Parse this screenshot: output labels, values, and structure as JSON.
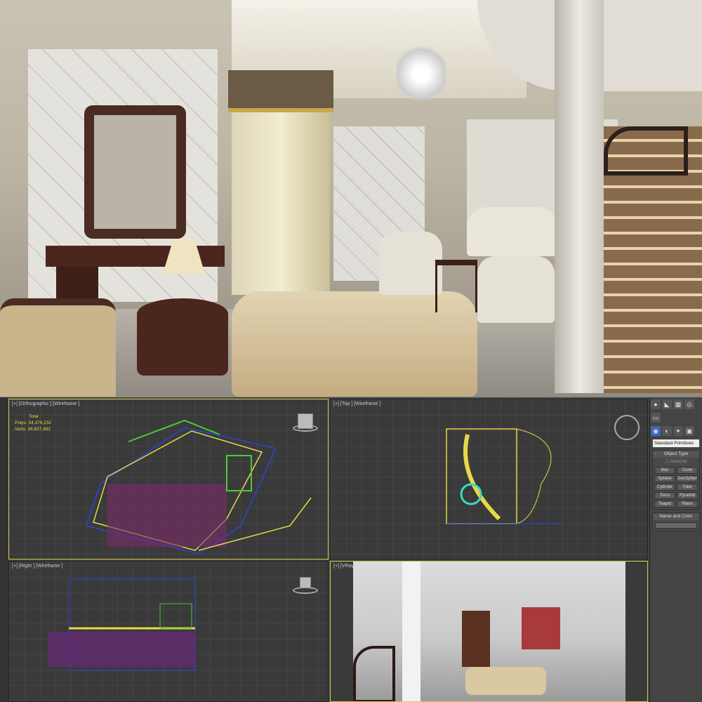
{
  "viewports": [
    {
      "label": "[+] [Orthographic ] [Wireframe ]",
      "stats": {
        "title": "Total",
        "polys_label": "Polys:",
        "polys": "54,376,232",
        "verts_label": "Verts:",
        "verts": "34,607,482"
      }
    },
    {
      "label": "[+] [Top ] [Wireframe ]"
    },
    {
      "label": "[+] [Right ] [Wireframe ]"
    },
    {
      "label": "[+] [VRayPhysicalCamera ] [Realistic ]"
    }
  ],
  "command_panel": {
    "category": "Standard Primitives",
    "object_type": {
      "title": "Object Type",
      "autogrid": "AutoGrid",
      "buttons": [
        "Box",
        "Cone",
        "Sphere",
        "GeoSphere",
        "Cylinder",
        "Tube",
        "Torus",
        "Pyramid",
        "Teapot",
        "Plane"
      ]
    },
    "name_color": {
      "title": "Name and Color"
    }
  },
  "colors": {
    "active_border": "#d6c84a",
    "stats_text": "#e8d84a",
    "wire_yellow": "#e8d84a",
    "wire_blue": "#2a44d8",
    "wire_green": "#4ec83a"
  }
}
